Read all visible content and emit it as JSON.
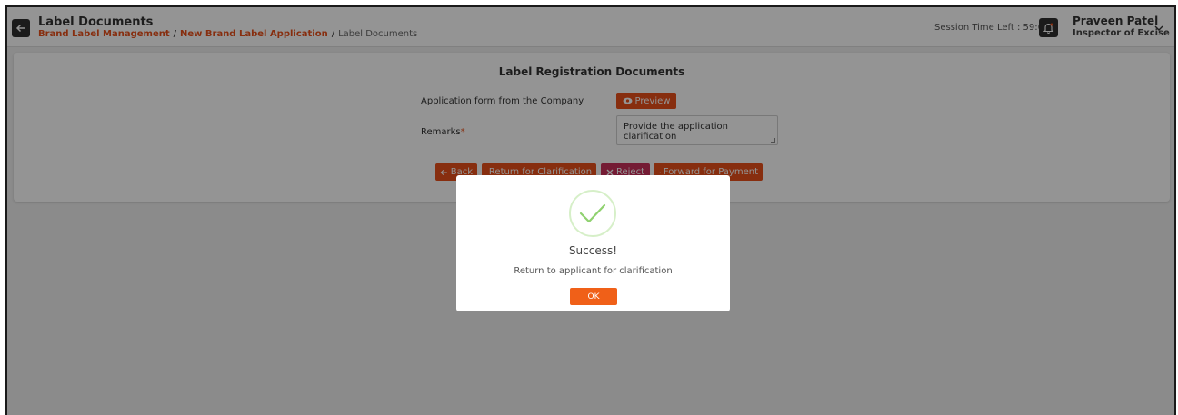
{
  "header": {
    "title": "Label Documents",
    "breadcrumb": [
      {
        "label": "Brand Label Management",
        "link": true
      },
      {
        "label": "New Brand Label Application",
        "link": true
      },
      {
        "label": "Label Documents",
        "link": false
      }
    ],
    "separator": "/",
    "session_time": "Session Time Left : 59:01",
    "user_name": "Praveen Patel",
    "user_role": "Inspector of Excise"
  },
  "card": {
    "title": "Label Registration Documents",
    "application_label": "Application form from the Company",
    "preview_label": "Preview",
    "remarks_label": "Remarks",
    "remarks_required": "*",
    "remarks_value": "Provide the application clarification"
  },
  "actions": {
    "back": "Back",
    "return": "Return for Clarification",
    "reject": "Reject",
    "forward": "Forward for Payment"
  },
  "modal": {
    "title": "Success!",
    "message": "Return to applicant for clarification",
    "ok": "OK"
  },
  "colors": {
    "accent": "#e8501a",
    "reject": "#c8305a",
    "success": "#8fd16f",
    "dark_button": "#2f2f2f"
  },
  "icons": [
    "arrow-left-icon",
    "bell-icon",
    "chevron-down-icon",
    "eye-icon",
    "check-icon",
    "x-icon",
    "success-check-icon"
  ]
}
